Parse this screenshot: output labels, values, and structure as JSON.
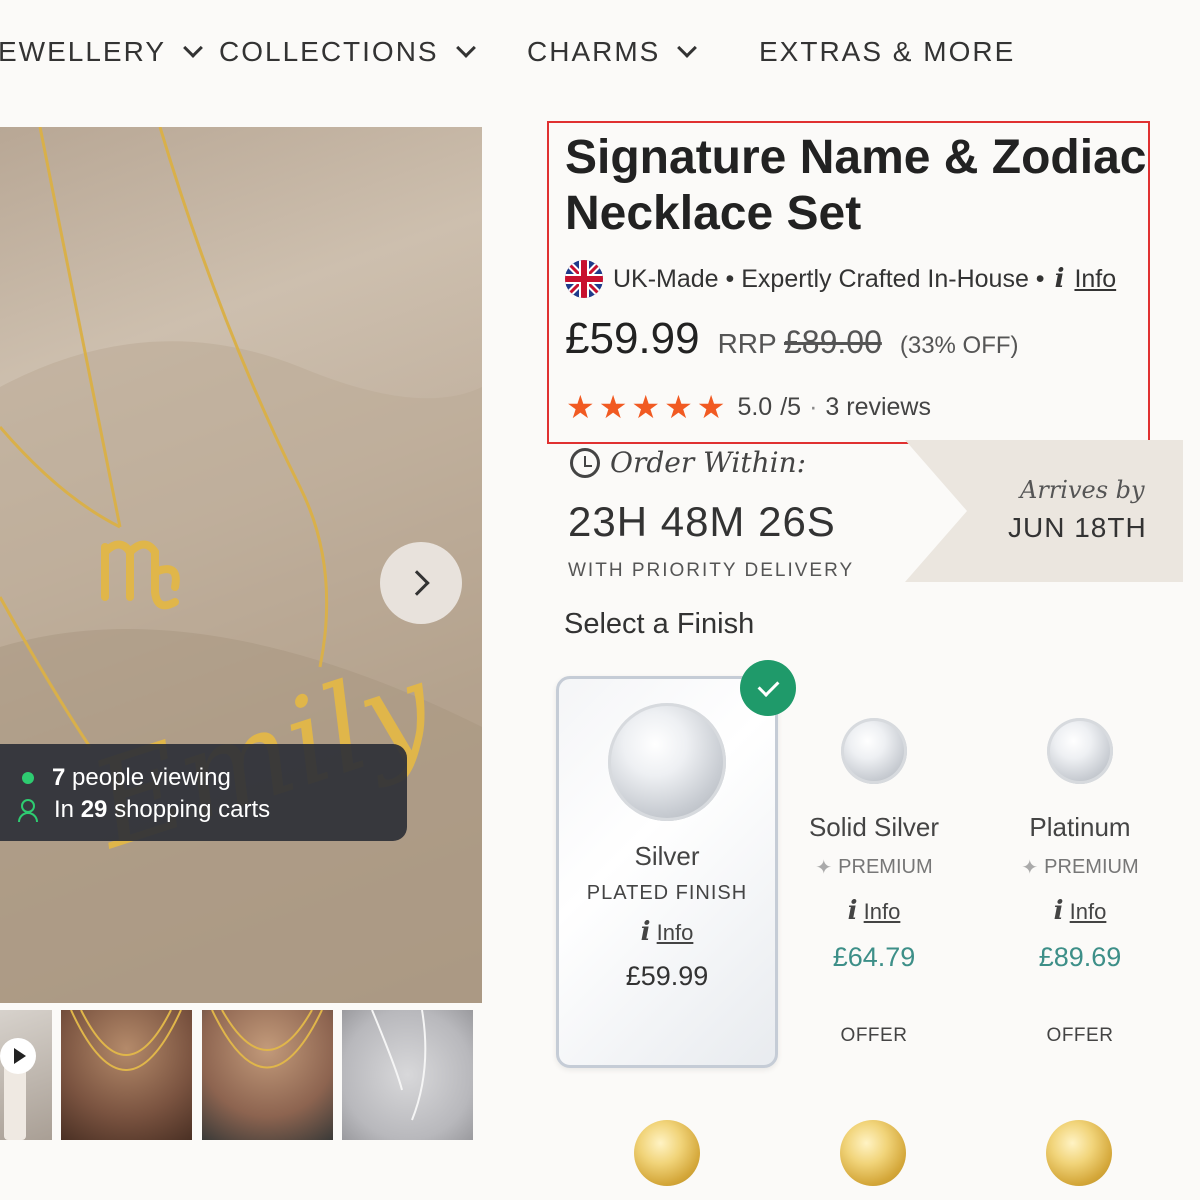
{
  "nav": {
    "items": [
      {
        "label": "JEWELLERY"
      },
      {
        "label": "COLLECTIONS"
      },
      {
        "label": "CHARMS"
      },
      {
        "label": "EXTRAS & MORE"
      }
    ]
  },
  "gallery": {
    "pendant_name": "Emily",
    "viewing_count": "7",
    "viewing_text": "people viewing",
    "carts_prefix": "In",
    "carts_count": "29",
    "carts_text": "shopping carts"
  },
  "product": {
    "title": "Signature Name & Zodiac Necklace Set",
    "made_text": "UK-Made • Expertly Crafted In-House •",
    "info_label": "Info",
    "price": "£59.99",
    "rrp_label": "RRP",
    "rrp_price": "£89.00",
    "discount": "(33% OFF)",
    "stars": "★★★★★",
    "rating": "5.0",
    "rating_max": "/5",
    "rating_sep": "·",
    "reviews": "3 reviews"
  },
  "delivery": {
    "order_within": "Order Within:",
    "countdown": "23H 48M 26S",
    "priority": "WITH PRIORITY DELIVERY",
    "arrives_label": "Arrives by",
    "arrives_date": "JUN 18TH"
  },
  "finish": {
    "heading": "Select a Finish",
    "options": [
      {
        "name": "Silver",
        "sub": "PLATED FINISH",
        "info": "Info",
        "price": "£59.99",
        "selected": true
      },
      {
        "name": "Solid Silver",
        "sub": "PREMIUM",
        "info": "Info",
        "price": "£64.79",
        "tag": "OFFER"
      },
      {
        "name": "Platinum",
        "sub": "PREMIUM",
        "info": "Info",
        "price": "£89.69",
        "tag": "OFFER"
      }
    ]
  },
  "colors": {
    "highlight": "#e03131",
    "stars": "#f15a22",
    "selected_check": "#1f9a6a",
    "price_teal": "#3d8f88",
    "viewing_dot": "#2ecc71"
  }
}
